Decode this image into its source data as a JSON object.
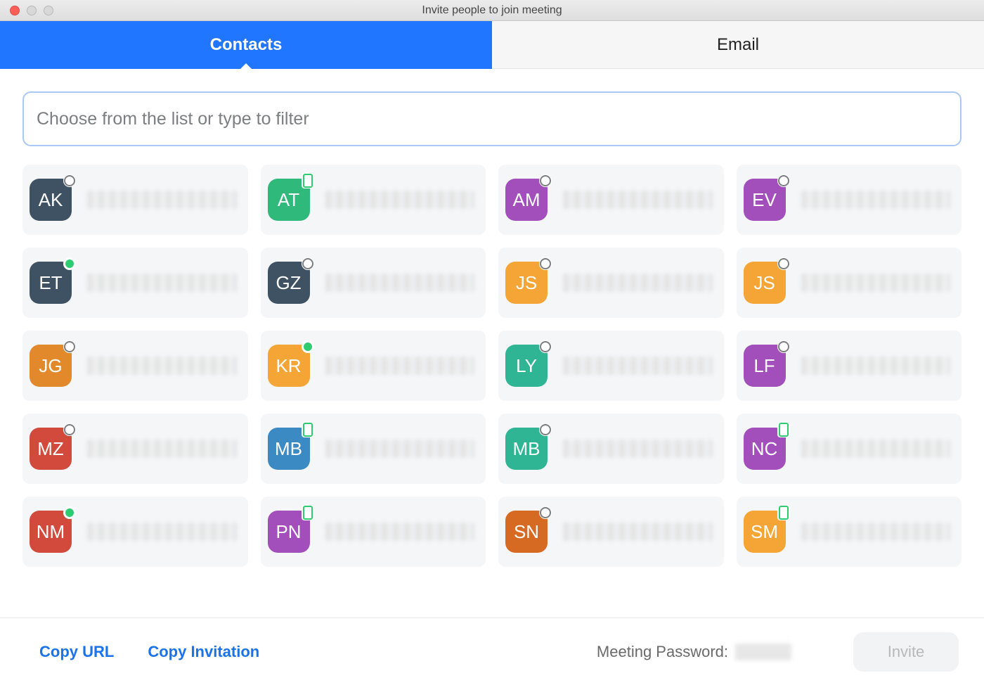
{
  "window": {
    "title": "Invite people to join meeting"
  },
  "tabs": {
    "contacts": "Contacts",
    "email": "Email"
  },
  "search": {
    "placeholder": "Choose from the list or type to filter",
    "value": ""
  },
  "avatar_colors": {
    "slate": "#3f5264",
    "green": "#2fba7b",
    "purple": "#a34fbb",
    "orange": "#f4a535",
    "orange2": "#e28a2b",
    "teal": "#2fb494",
    "red": "#d24a3c",
    "blue": "#3b8ac4",
    "darkorange": "#d76a22"
  },
  "contacts": [
    {
      "initials": "AK",
      "color": "slate",
      "status": "offline"
    },
    {
      "initials": "AT",
      "color": "green",
      "status": "mobile"
    },
    {
      "initials": "AM",
      "color": "purple",
      "status": "offline"
    },
    {
      "initials": "EV",
      "color": "purple",
      "status": "offline"
    },
    {
      "initials": "ET",
      "color": "slate",
      "status": "online"
    },
    {
      "initials": "GZ",
      "color": "slate",
      "status": "offline"
    },
    {
      "initials": "JS",
      "color": "orange",
      "status": "offline"
    },
    {
      "initials": "JS",
      "color": "orange",
      "status": "offline"
    },
    {
      "initials": "JG",
      "color": "orange2",
      "status": "offline"
    },
    {
      "initials": "KR",
      "color": "orange",
      "status": "online"
    },
    {
      "initials": "LY",
      "color": "teal",
      "status": "offline"
    },
    {
      "initials": "LF",
      "color": "purple",
      "status": "offline"
    },
    {
      "initials": "MZ",
      "color": "red",
      "status": "offline"
    },
    {
      "initials": "MB",
      "color": "blue",
      "status": "mobile"
    },
    {
      "initials": "MB",
      "color": "teal",
      "status": "offline"
    },
    {
      "initials": "NC",
      "color": "purple",
      "status": "mobile"
    },
    {
      "initials": "NM",
      "color": "red",
      "status": "online"
    },
    {
      "initials": "PN",
      "color": "purple",
      "status": "mobile"
    },
    {
      "initials": "SN",
      "color": "darkorange",
      "status": "offline"
    },
    {
      "initials": "SM",
      "color": "orange",
      "status": "mobile"
    }
  ],
  "footer": {
    "copy_url": "Copy URL",
    "copy_invitation": "Copy Invitation",
    "meeting_password_label": "Meeting Password:",
    "invite": "Invite"
  }
}
